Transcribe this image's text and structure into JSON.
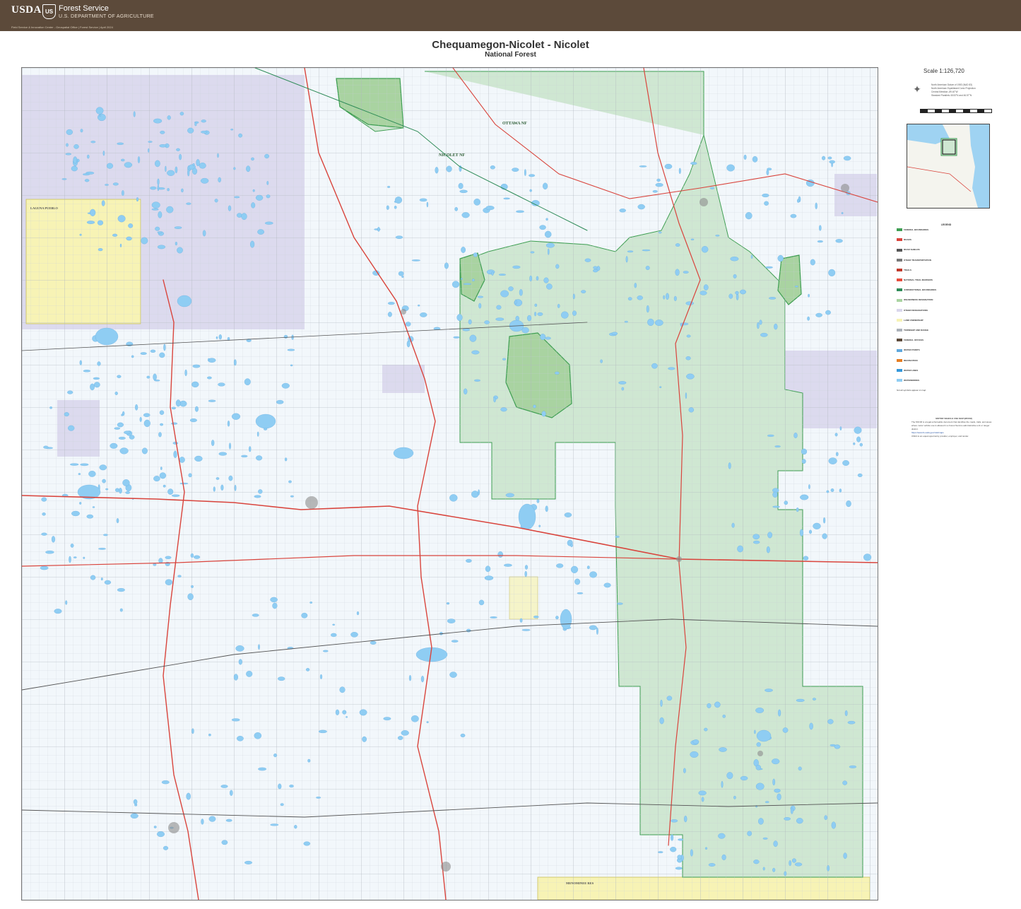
{
  "header": {
    "usda": "USDA",
    "shield": "US",
    "agency": "Forest Service",
    "department": "U.S. DEPARTMENT OF AGRICULTURE",
    "credit": "Field Service & Innovation Center - Geospatial Office | Forest Service | April 2024"
  },
  "map": {
    "title": "Chequamegon-Nicolet - Nicolet",
    "subtitle": "National Forest",
    "scale": "Scale 1:126,720",
    "labels": {
      "nicolet_nf": "NICOLET NF",
      "ottawa_nf": "OTTAWA NF",
      "laguna_pueblo": "LAGUNA PUEBLO",
      "menominee": "MENOMINEE RES"
    },
    "colors": {
      "forest": "#cfe7d2",
      "forest_border": "#3e9e52",
      "wilderness": "#a8d4a0",
      "water": "#9fd3f2",
      "state_land": "#d7d3ea",
      "tribal": "#f7f3b5",
      "road_primary": "#d9443c",
      "road_secondary": "#555555",
      "header": "#5c4a3a"
    }
  },
  "panel": {
    "datum": [
      "North American Datum of 1983 (NAD 83)",
      "North American Equidistant Conic Projection",
      "Central Meridian -89.40°W",
      "Standard Parallels 45.53°N and 46.57°N"
    ],
    "legend_title": "LEGEND",
    "legend_sections": [
      "FEDERAL BOUNDARIES",
      "ROADS",
      "ROAD SHIELDS",
      "OTHER TRANSPORTATION",
      "TRAILS",
      "NATIONAL TRAIL MARKERS",
      "JURISDICTIONAL BOUNDARIES",
      "WILDERNESS DESIGNATION",
      "OTHER DESIGNATIONS",
      "LAND OWNERSHIP",
      "TOWNSHIP AND RANGE",
      "FEDERAL OFFICES",
      "WATER POINTS",
      "RECREATION",
      "WATER LINES",
      "WATERBODIES"
    ],
    "legend_note": "Not all symbols appear on map",
    "mvum_title": "MOTOR VEHICLE USE MAP (MVUM)",
    "mvum_text": "The MVUM is a legal enforceable document that identifies the roads, trails, and areas where motor vehicle use is allowed in a Forest Service administrative unit or ranger district.",
    "mvum_link": "https://www.fs.usda.gov/visit/maps",
    "usda_note": "USDA is an equal opportunity provider, employer, and lender."
  }
}
